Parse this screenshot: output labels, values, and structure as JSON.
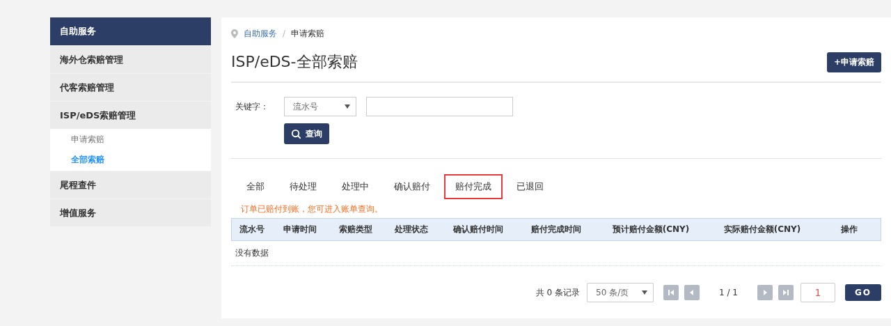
{
  "sidebar": {
    "header": "自助服务",
    "items": [
      {
        "label": "海外仓索赔管理"
      },
      {
        "label": "代客索赔管理"
      },
      {
        "label": "ISP/eDS索赔管理",
        "children": [
          {
            "label": "申请索赔",
            "selected": false
          },
          {
            "label": "全部索赔",
            "selected": true
          }
        ]
      },
      {
        "label": "尾程查件"
      },
      {
        "label": "增值服务"
      }
    ]
  },
  "breadcrumb": [
    "自助服务",
    "/",
    "申请索赔"
  ],
  "title": "ISP/eDS-全部索赔",
  "apply_button": "+申请索赔",
  "filter": {
    "label": "关键字：",
    "select": "流水号",
    "query_button": "查询"
  },
  "tabs": [
    {
      "label": "全部",
      "selected": false
    },
    {
      "label": "待处理",
      "selected": false
    },
    {
      "label": "处理中",
      "selected": false
    },
    {
      "label": "确认赔付",
      "selected": false
    },
    {
      "label": "赔付完成",
      "selected": true
    },
    {
      "label": "已退回",
      "selected": false
    }
  ],
  "notice": "订单已赔付到账，您可进入账单查询。",
  "table": {
    "columns": [
      "流水号",
      "申请时间",
      "索赔类型",
      "处理状态",
      "确认赔付时间",
      "赔付完成时间",
      "预计赔付金额(CNY)",
      "实际赔付金额(CNY)",
      "操作"
    ],
    "empty": "没有数据"
  },
  "pagination": {
    "total": "共 0 条记录",
    "page_size": "50 条/页",
    "page": "1 / 1",
    "page_input": "1",
    "go": "GO"
  }
}
